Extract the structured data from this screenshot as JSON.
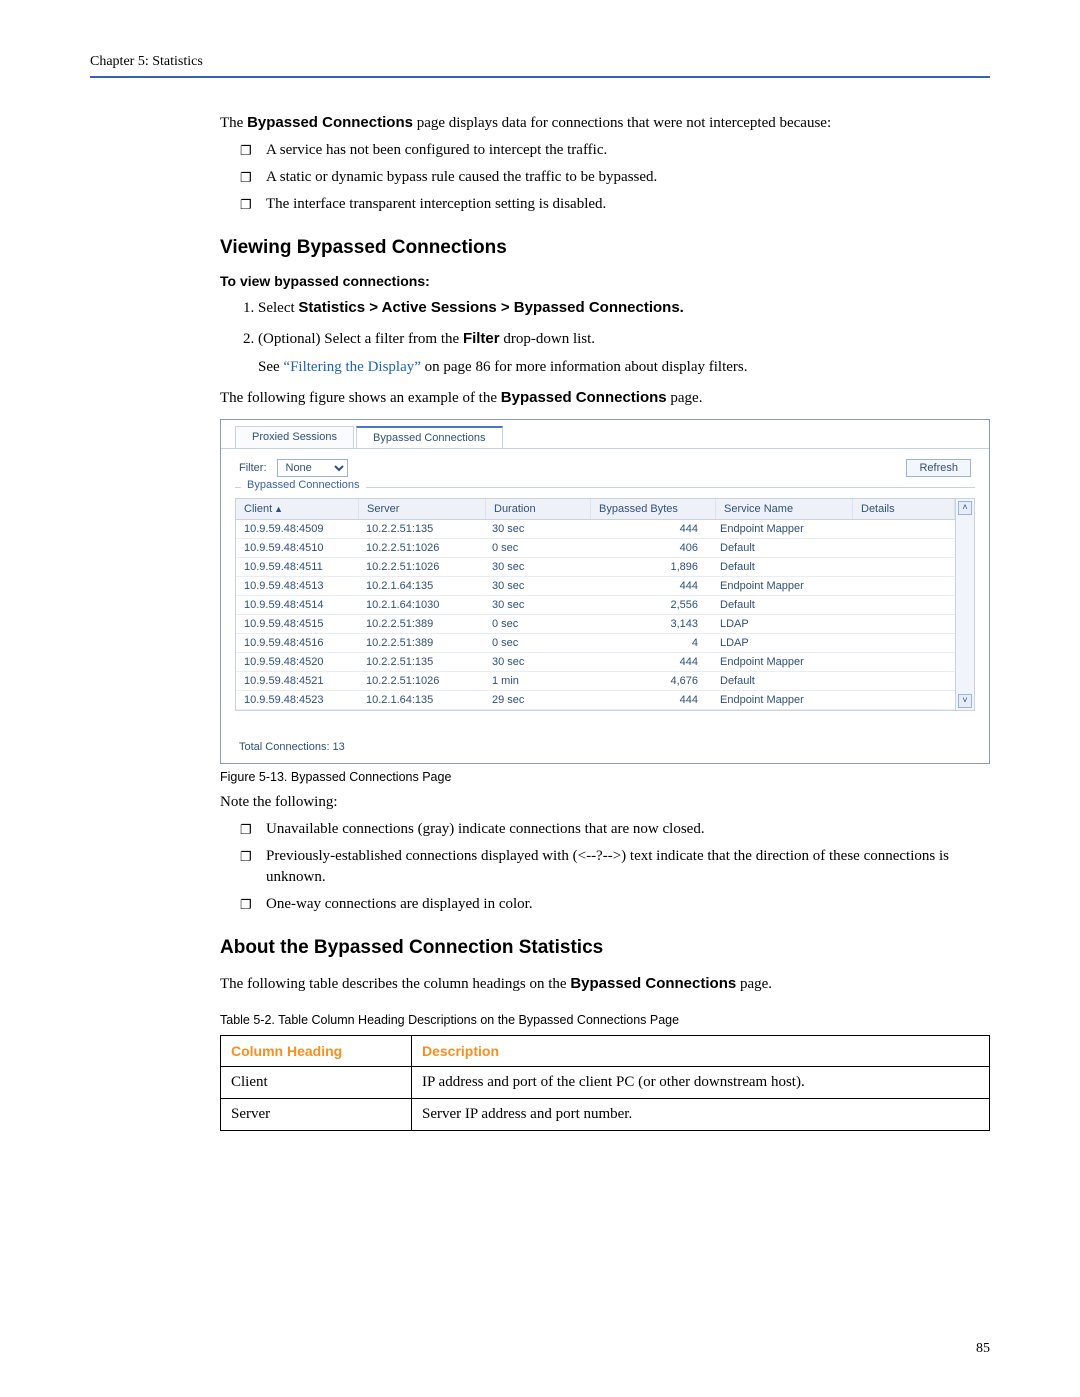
{
  "header": {
    "chapter": "Chapter 5:   Statistics"
  },
  "intro": {
    "p1_a": "The ",
    "p1_bold": "Bypassed Connections",
    "p1_b": " page displays data for connections that were not intercepted because:",
    "bullets": [
      "A service has not been configured to intercept the traffic.",
      "A static or dynamic bypass rule caused the traffic to be bypassed.",
      "The interface transparent interception setting is disabled."
    ]
  },
  "section1": {
    "title": "Viewing Bypassed Connections",
    "subhead": "To view bypassed connections:",
    "step1_a": "Select ",
    "step1_bold": "Statistics > Active Sessions > Bypassed Connections.",
    "step2_a": "(Optional) Select a filter from the ",
    "step2_bold": "Filter",
    "step2_b": " drop-down list.",
    "see_a": "See ",
    "see_link": "“Filtering the Display”",
    "see_b": "  on page 86 for more information about display filters.",
    "after_a": "The following figure shows an example of the ",
    "after_bold": "Bypassed Connections",
    "after_b": " page."
  },
  "figure": {
    "tabs": {
      "proxied": "Proxied Sessions",
      "bypassed": "Bypassed Connections"
    },
    "filter_label": "Filter:",
    "filter_value": "None",
    "refresh": "Refresh",
    "group_label": "Bypassed Connections",
    "cols": {
      "client": "Client",
      "server": "Server",
      "duration": "Duration",
      "bytes": "Bypassed Bytes",
      "service": "Service Name",
      "details": "Details"
    },
    "rows": [
      {
        "client": "10.9.59.48:4509",
        "server": "10.2.2.51:135",
        "duration": "30 sec",
        "bytes": "444",
        "service": "Endpoint Mapper",
        "details": ""
      },
      {
        "client": "10.9.59.48:4510",
        "server": "10.2.2.51:1026",
        "duration": "0 sec",
        "bytes": "406",
        "service": "Default",
        "details": ""
      },
      {
        "client": "10.9.59.48:4511",
        "server": "10.2.2.51:1026",
        "duration": "30 sec",
        "bytes": "1,896",
        "service": "Default",
        "details": ""
      },
      {
        "client": "10.9.59.48:4513",
        "server": "10.2.1.64:135",
        "duration": "30 sec",
        "bytes": "444",
        "service": "Endpoint Mapper",
        "details": ""
      },
      {
        "client": "10.9.59.48:4514",
        "server": "10.2.1.64:1030",
        "duration": "30 sec",
        "bytes": "2,556",
        "service": "Default",
        "details": ""
      },
      {
        "client": "10.9.59.48:4515",
        "server": "10.2.2.51:389",
        "duration": "0 sec",
        "bytes": "3,143",
        "service": "LDAP",
        "details": ""
      },
      {
        "client": "10.9.59.48:4516",
        "server": "10.2.2.51:389",
        "duration": "0 sec",
        "bytes": "4",
        "service": "LDAP",
        "details": ""
      },
      {
        "client": "10.9.59.48:4520",
        "server": "10.2.2.51:135",
        "duration": "30 sec",
        "bytes": "444",
        "service": "Endpoint Mapper",
        "details": ""
      },
      {
        "client": "10.9.59.48:4521",
        "server": "10.2.2.51:1026",
        "duration": "1 min",
        "bytes": "4,676",
        "service": "Default",
        "details": ""
      },
      {
        "client": "10.9.59.48:4523",
        "server": "10.2.1.64:135",
        "duration": "29 sec",
        "bytes": "444",
        "service": "Endpoint Mapper",
        "details": ""
      }
    ],
    "totals": "Total Connections: 13",
    "caption": "Figure 5-13.  Bypassed Connections Page"
  },
  "notes": {
    "lead": "Note the following:",
    "bullets": [
      "Unavailable connections (gray) indicate connections that are now closed.",
      "Previously-established connections displayed with (<--?-->) text indicate that the direction of these connections is unknown.",
      "One-way connections are displayed in color."
    ]
  },
  "section2": {
    "title": "About the Bypassed Connection Statistics",
    "p_a": "The following table describes the column headings on the ",
    "p_bold": "Bypassed Connections",
    "p_b": " page.",
    "caption": "Table 5-2.  Table Column Heading Descriptions on the Bypassed Connections Page",
    "th1": "Column Heading",
    "th2": "Description",
    "rows": [
      {
        "h": "Client",
        "d": "IP address and port of the client PC (or other downstream host)."
      },
      {
        "h": "Server",
        "d": "Server IP address and port number."
      }
    ]
  },
  "pageno": "85"
}
